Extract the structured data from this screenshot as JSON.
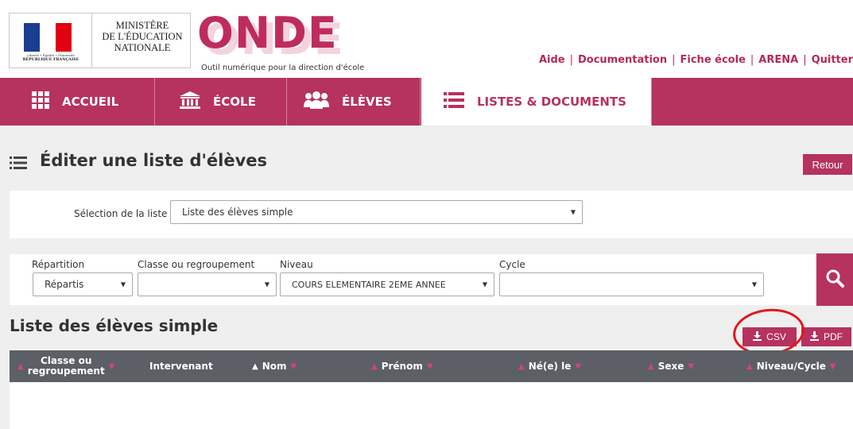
{
  "header": {
    "marianne_motto": "Liberté • Égalité • Fraternité",
    "republique": "RÉPUBLIQUE FRANÇAISE",
    "ministry_lines": [
      "MINISTÈRE",
      "DE L'ÉDUCATION",
      "NATIONALE"
    ],
    "app_name": "ONDE",
    "tagline": "Outil numérique pour la direction d'école",
    "links": [
      "Aide",
      "Documentation",
      "Fiche école",
      "ARENA",
      "Quitter"
    ]
  },
  "nav": {
    "items": [
      {
        "label": "ACCUEIL",
        "icon": "grid-icon"
      },
      {
        "label": "ÉCOLE",
        "icon": "building-icon"
      },
      {
        "label": "ÉLÈVES",
        "icon": "people-icon"
      },
      {
        "label": "LISTES & DOCUMENTS",
        "icon": "list-icon",
        "active": true
      }
    ]
  },
  "page": {
    "title": "Éditer une liste d'élèves",
    "back_button": "Retour"
  },
  "selection": {
    "label": "Sélection de la liste",
    "value": "Liste des élèves simple"
  },
  "filters": {
    "repartition": {
      "label": "Répartition",
      "value": "Répartis"
    },
    "classe": {
      "label": "Classe ou regroupement",
      "value": ""
    },
    "niveau": {
      "label": "Niveau",
      "value": "COURS ELEMENTAIRE 2EME ANNEE"
    },
    "cycle": {
      "label": "Cycle",
      "value": ""
    }
  },
  "list": {
    "title": "Liste des élèves simple",
    "csv_button": "CSV",
    "pdf_button": "PDF",
    "columns": {
      "classe_line1": "Classe ou",
      "classe_line2": "regroupement",
      "intervenant": "Intervenant",
      "nom": "Nom",
      "prenom": "Prénom",
      "ne_le": "Né(e) le",
      "sexe": "Sexe",
      "niveau_cycle": "Niveau/Cycle"
    }
  },
  "colors": {
    "brand": "#b6325f",
    "table_header": "#5c5f66",
    "highlight_circle": "#e01818"
  }
}
